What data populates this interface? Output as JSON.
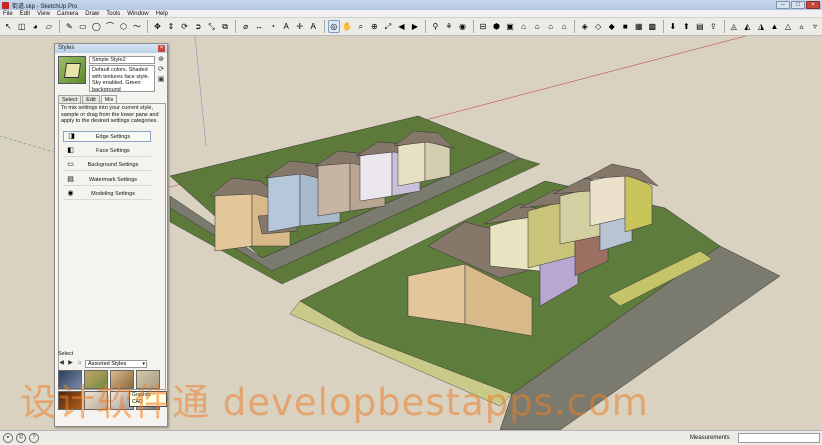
{
  "window": {
    "title": "街道.skp - SketchUp Pro",
    "controls": {
      "minimize": "–",
      "maximize": "□",
      "close": "×"
    }
  },
  "menu": [
    "File",
    "Edit",
    "View",
    "Camera",
    "Draw",
    "Tools",
    "Window",
    "Help"
  ],
  "toolbar": {
    "groups": [
      [
        {
          "icon": "select-arrow-icon",
          "glyph": "↖"
        },
        {
          "icon": "component-icon",
          "glyph": "◫"
        },
        {
          "icon": "paint-bucket-icon",
          "glyph": "◕"
        },
        {
          "icon": "eraser-icon",
          "glyph": "▱"
        }
      ],
      [
        {
          "icon": "pencil-icon",
          "glyph": "✎"
        },
        {
          "icon": "rectangle-icon",
          "glyph": "▭"
        },
        {
          "icon": "circle-icon",
          "glyph": "◯"
        },
        {
          "icon": "arc-icon",
          "glyph": "⌒"
        },
        {
          "icon": "polygon-icon",
          "glyph": "⬡"
        },
        {
          "icon": "freehand-icon",
          "glyph": "〜"
        }
      ],
      [
        {
          "icon": "move-icon",
          "glyph": "✥"
        },
        {
          "icon": "push-pull-icon",
          "glyph": "⇕"
        },
        {
          "icon": "rotate-icon",
          "glyph": "⟳"
        },
        {
          "icon": "follow-me-icon",
          "glyph": "➲"
        },
        {
          "icon": "scale-icon",
          "glyph": "⤡"
        },
        {
          "icon": "offset-icon",
          "glyph": "⧉"
        }
      ],
      [
        {
          "icon": "tape-measure-icon",
          "glyph": "⌀"
        },
        {
          "icon": "dimension-icon",
          "glyph": "↔"
        },
        {
          "icon": "protractor-icon",
          "glyph": "◔"
        },
        {
          "icon": "text-icon",
          "glyph": "A"
        },
        {
          "icon": "axes-icon",
          "glyph": "✛"
        },
        {
          "icon": "3d-text-icon",
          "glyph": "Ａ"
        }
      ],
      [
        {
          "icon": "orbit-icon",
          "glyph": "◎",
          "active": true
        },
        {
          "icon": "pan-icon",
          "glyph": "✋"
        },
        {
          "icon": "zoom-icon",
          "glyph": "⌕"
        },
        {
          "icon": "zoom-window-icon",
          "glyph": "⊕"
        },
        {
          "icon": "zoom-extents-icon",
          "glyph": "⤢"
        },
        {
          "icon": "previous-view-icon",
          "glyph": "◀"
        },
        {
          "icon": "next-view-icon",
          "glyph": "▶"
        }
      ],
      [
        {
          "icon": "position-camera-icon",
          "glyph": "⚲"
        },
        {
          "icon": "walk-icon",
          "glyph": "⚘"
        },
        {
          "icon": "look-around-icon",
          "glyph": "◉"
        }
      ],
      [
        {
          "icon": "section-plane-icon",
          "glyph": "⊟"
        },
        {
          "icon": "iso-view-icon",
          "glyph": "⬢"
        },
        {
          "icon": "top-view-icon",
          "glyph": "▣"
        },
        {
          "icon": "front-view-icon",
          "glyph": "⌂"
        },
        {
          "icon": "right-view-icon",
          "glyph": "⌂"
        },
        {
          "icon": "back-view-icon",
          "glyph": "⌂"
        },
        {
          "icon": "left-view-icon",
          "glyph": "⌂"
        }
      ],
      [
        {
          "icon": "xray-icon",
          "glyph": "◈"
        },
        {
          "icon": "wireframe-icon",
          "glyph": "◇"
        },
        {
          "icon": "hidden-line-icon",
          "glyph": "◆"
        },
        {
          "icon": "shaded-icon",
          "glyph": "■"
        },
        {
          "icon": "shaded-textures-icon",
          "glyph": "▦"
        },
        {
          "icon": "monochrome-icon",
          "glyph": "▩"
        }
      ],
      [
        {
          "icon": "get-models-icon",
          "glyph": "⬇"
        },
        {
          "icon": "share-model-icon",
          "glyph": "⬆"
        },
        {
          "icon": "get-photo-texture-icon",
          "glyph": "▤"
        },
        {
          "icon": "share-component-icon",
          "glyph": "⇪"
        }
      ],
      [
        {
          "icon": "sandbox-contours-icon",
          "glyph": "◬"
        },
        {
          "icon": "sandbox-scratch-icon",
          "glyph": "◭"
        },
        {
          "icon": "sandbox-smoove-icon",
          "glyph": "◮"
        },
        {
          "icon": "sandbox-stamp-icon",
          "glyph": "▲"
        },
        {
          "icon": "sandbox-drape-icon",
          "glyph": "△"
        },
        {
          "icon": "sandbox-detail-icon",
          "glyph": "▵"
        },
        {
          "icon": "sandbox-flip-icon",
          "glyph": "▿"
        }
      ]
    ]
  },
  "styles_panel": {
    "title": "Styles",
    "close": "×",
    "style_name": "Simple Style2",
    "style_description": "Default colors.  Shaded with textures face style.  Sky enabled.  Green background",
    "side_icons": [
      {
        "icon": "create-style-icon",
        "glyph": "⊕"
      },
      {
        "icon": "update-style-icon",
        "glyph": "⟳"
      },
      {
        "icon": "detail-toggle-icon",
        "glyph": "▣"
      }
    ],
    "tabs": [
      {
        "label": "Select",
        "selected": false
      },
      {
        "label": "Edit",
        "selected": false
      },
      {
        "label": "Mix",
        "selected": true
      }
    ],
    "mix_help": "To mix settings into your current style, sample or drag from the lower pane and apply to the desired settings categories.",
    "mix_rows": [
      {
        "label": "Edge Settings",
        "icon": "edge-settings-icon",
        "glyph": "◨",
        "active": true
      },
      {
        "label": "Face Settings",
        "icon": "face-settings-icon",
        "glyph": "◧",
        "active": false
      },
      {
        "label": "Background Settings",
        "icon": "background-settings-icon",
        "glyph": "▭",
        "active": false
      },
      {
        "label": "Watermark Settings",
        "icon": "watermark-settings-icon",
        "glyph": "▤",
        "active": false
      },
      {
        "label": "Modeling Settings",
        "icon": "modeling-settings-icon",
        "glyph": "◉",
        "active": false
      }
    ],
    "select_label": "Select",
    "select_nav": [
      {
        "icon": "back-icon",
        "glyph": "◀"
      },
      {
        "icon": "forward-icon",
        "glyph": "▶"
      },
      {
        "icon": "home-icon",
        "glyph": "⌂"
      }
    ],
    "collection": "Assorted Styles",
    "collection_caret": "▾",
    "tooltip": "Graphite - CAD",
    "thumbnails": [
      {
        "c1": "#2b3d5c",
        "c2": "#7a8aa8"
      },
      {
        "c1": "#c9a26a",
        "c2": "#6c8d3d"
      },
      {
        "c1": "#d9b98a",
        "c2": "#8a6a3e"
      },
      {
        "c1": "#d4c7a5",
        "c2": "#a89e88"
      },
      {
        "c1": "#4a2a10",
        "c2": "#b45c1c"
      },
      {
        "c1": "#e9e4d6",
        "c2": "#b8a690"
      },
      {
        "c1": "#ebe6dc",
        "c2": "#9b9b9b"
      },
      {
        "c1": "#d8cdb3",
        "c2": "#6f6f6f"
      }
    ]
  },
  "statusbar": {
    "icons": [
      {
        "icon": "geo-location-icon",
        "glyph": "⌖"
      },
      {
        "icon": "credits-icon",
        "glyph": "©"
      },
      {
        "icon": "help-icon",
        "glyph": "?"
      }
    ],
    "measurements_label": "Measurements"
  },
  "watermark_text": "设计软件通 developbestapps.com"
}
